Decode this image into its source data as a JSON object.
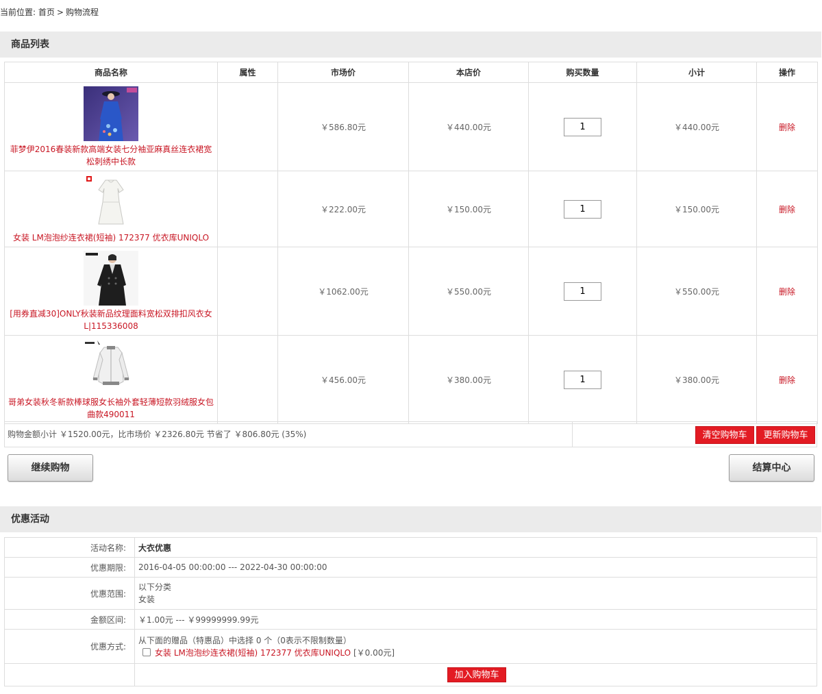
{
  "breadcrumb": {
    "prefix": "当前位置:",
    "home": "首页",
    "separator": ">",
    "current": "购物流程"
  },
  "cart": {
    "section_title": "商品列表",
    "columns": [
      "商品名称",
      "属性",
      "市场价",
      "本店价",
      "购买数量",
      "小计",
      "操作"
    ],
    "rows": [
      {
        "name": "菲梦伊2016春装新款高端女装七分袖亚麻真丝连衣裙宽松刺绣中长款",
        "attr": "",
        "market_price": "￥586.80元",
        "shop_price": "￥440.00元",
        "qty": "1",
        "subtotal": "￥440.00元",
        "action": "删除"
      },
      {
        "name": "女装 LM泡泡纱连衣裙(短袖) 172377 优衣库UNIQLO",
        "attr": "",
        "market_price": "￥222.00元",
        "shop_price": "￥150.00元",
        "qty": "1",
        "subtotal": "￥150.00元",
        "action": "删除"
      },
      {
        "name": "[用券直减30]ONLY秋装新品纹理面料宽松双排扣风衣女L|115336008",
        "attr": "",
        "market_price": "￥1062.00元",
        "shop_price": "￥550.00元",
        "qty": "1",
        "subtotal": "￥550.00元",
        "action": "删除"
      },
      {
        "name": "哥弟女装秋冬新款棒球服女长袖外套轻薄短款羽绒服女包曲款490011",
        "attr": "",
        "market_price": "￥456.00元",
        "shop_price": "￥380.00元",
        "qty": "1",
        "subtotal": "￥380.00元",
        "action": "删除"
      }
    ],
    "summary_text": "购物金额小计 ￥1520.00元，比市场价 ￥2326.80元 节省了 ￥806.80元 (35%)",
    "clear_label": "清空购物车",
    "update_label": "更新购物车",
    "continue_label": "继续购物",
    "checkout_label": "结算中心"
  },
  "promo": {
    "section_title": "优惠活动",
    "name_label": "活动名称:",
    "name_value": "大衣优惠",
    "period_label": "优惠期限:",
    "period_value": "2016-04-05 00:00:00 --- 2022-04-30 00:00:00",
    "scope_label": "优惠范围:",
    "scope_line1": "以下分类",
    "scope_line2": "女装",
    "amount_label": "金额区间:",
    "amount_value": "￥1.00元 --- ￥99999999.99元",
    "method_label": "优惠方式:",
    "method_line": "从下面的赠品（特惠品）中选择 0 个（0表示不限制数量）",
    "gift_name": "女装 LM泡泡纱连衣裙(短袖) 172377 优衣库UNIQLO",
    "gift_price": "[￥0.00元]",
    "add_to_cart_label": "加入购物车"
  },
  "colors": {
    "accent_red": "#e31b23",
    "link_red": "#c81623",
    "section_gray": "#ebebeb",
    "border": "#dddddd"
  }
}
